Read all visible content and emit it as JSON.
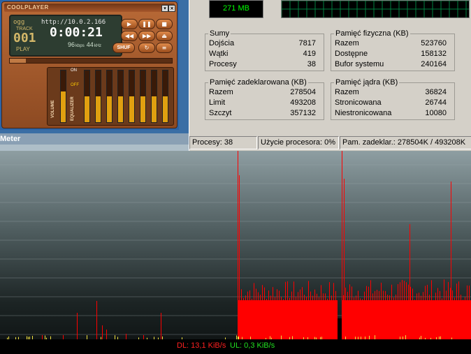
{
  "coolplayer": {
    "title": "COOLPLAYER",
    "format": "ogg",
    "track_label": "TRACK",
    "track_number": "001",
    "state": "PLAY",
    "url": "http://10.0.2.166",
    "time": "0:00:21",
    "kbps": "96",
    "kbps_unit": "kbps",
    "khz": "44",
    "khz_unit": "kHz",
    "shuffle_label": "SHUF",
    "volume_label": "VOLUME",
    "eq_label": "EQUALIZER",
    "eq_on": "ON",
    "eq_off": "OFF",
    "volume_level": 0.6,
    "eq_levels": [
      0.5,
      0.5,
      0.5,
      0.5,
      0.5,
      0.5,
      0.5,
      0.5
    ],
    "seek_progress": 0.1,
    "accent": "#b96a37"
  },
  "taskmanager": {
    "mem_usage": "271 MB",
    "sumy": {
      "title": "Sumy",
      "rows": [
        {
          "label": "Dojścia",
          "value": "7817"
        },
        {
          "label": "Wątki",
          "value": "419"
        },
        {
          "label": "Procesy",
          "value": "38"
        }
      ]
    },
    "fizyczna": {
      "title": "Pamięć fizyczna (KB)",
      "rows": [
        {
          "label": "Razem",
          "value": "523760"
        },
        {
          "label": "Dostępne",
          "value": "158132"
        },
        {
          "label": "Bufor systemu",
          "value": "240164"
        }
      ]
    },
    "zadeklarowana": {
      "title": "Pamięć zadeklarowana (KB)",
      "rows": [
        {
          "label": "Razem",
          "value": "278504"
        },
        {
          "label": "Limit",
          "value": "493208"
        },
        {
          "label": "Szczyt",
          "value": "357132"
        }
      ]
    },
    "jadra": {
      "title": "Pamięć jądra (KB)",
      "rows": [
        {
          "label": "Razem",
          "value": "36824"
        },
        {
          "label": "Stronicowana",
          "value": "26744"
        },
        {
          "label": "Niestronicowana",
          "value": "10080"
        }
      ]
    },
    "status": {
      "procesy": "Procesy: 38",
      "cpu": "Użycie procesora: 0%",
      "mem": "Pam. zadeklar.: 278504K / 493208K"
    }
  },
  "meter": {
    "title": "Meter",
    "dl": "DL: 13,1 KiB/s",
    "ul": "UL: 0,3 KiB/s",
    "dl_color": "#ff0000",
    "ul_color": "#00cc00"
  }
}
